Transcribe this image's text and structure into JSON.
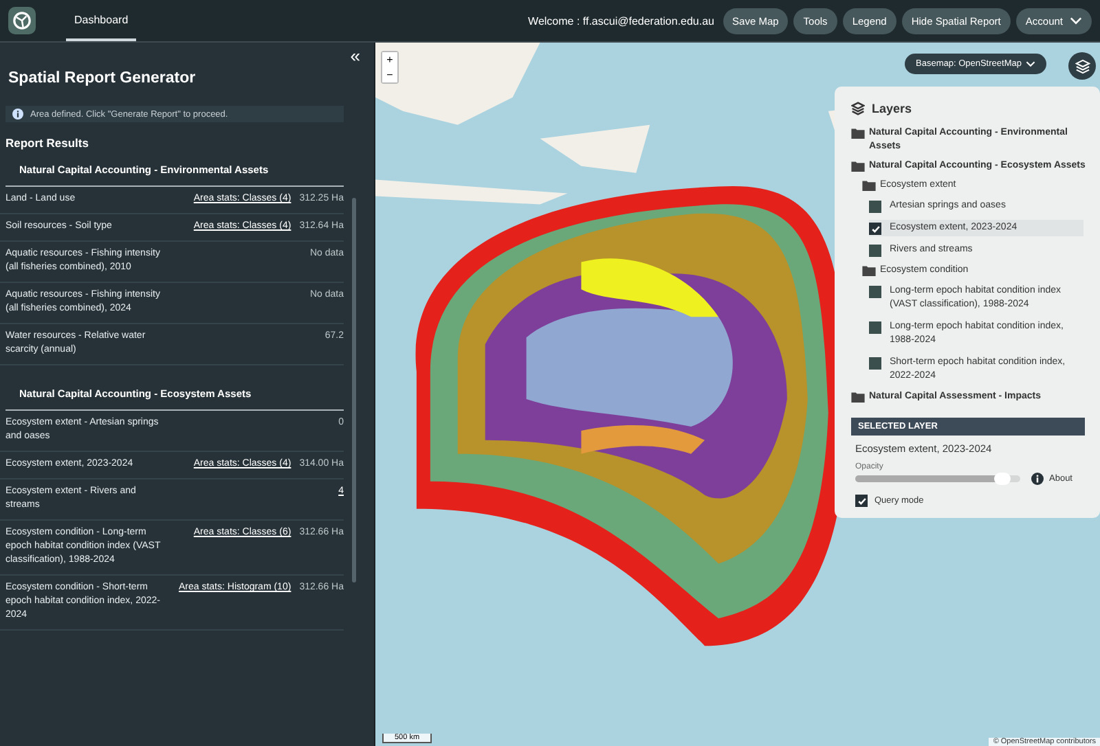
{
  "topbar": {
    "tabs": [
      {
        "label": "Dashboard",
        "selected": true
      }
    ],
    "welcome": "Welcome : ff.ascui@federation.edu.au",
    "buttons": [
      {
        "label": "Save Map",
        "kind": "plain"
      },
      {
        "label": "Tools",
        "kind": "plain"
      },
      {
        "label": "Legend",
        "kind": "plain"
      },
      {
        "label": "Hide Spatial Report",
        "kind": "plain"
      },
      {
        "label": "Account",
        "kind": "dropdown"
      }
    ]
  },
  "sidebar": {
    "collapse": "«",
    "title": "Spatial Report Generator",
    "alert": "Area defined. Click \"Generate Report\" to proceed.",
    "results_title": "Report Results",
    "sections": [
      {
        "title": "Natural Capital Accounting - Environmental Assets",
        "rows": [
          {
            "label": "Land - Land use",
            "link": "Area stats: Classes (4)",
            "value": "312.25 Ha"
          },
          {
            "label": "Soil resources - Soil type",
            "link": "Area stats: Classes (4)",
            "value": "312.64 Ha"
          },
          {
            "label": "Aquatic resources - Fishing intensity (all fisheries combined), 2010",
            "value": "No data"
          },
          {
            "label": "Aquatic resources - Fishing intensity (all fisheries combined), 2024",
            "value": "No data"
          },
          {
            "label": "Water resources - Relative water scarcity (annual)",
            "value": "67.2"
          }
        ]
      },
      {
        "title": "Natural Capital Accounting - Ecosystem Assets",
        "rows": [
          {
            "label": "Ecosystem extent - Artesian springs and oases",
            "value": "0"
          },
          {
            "label": "Ecosystem extent, 2023-2024",
            "link": "Area stats: Classes (4)",
            "value": "314.00 Ha"
          },
          {
            "label": "Ecosystem extent - Rivers and streams",
            "link": "4"
          },
          {
            "label": "Ecosystem condition - Long-term epoch habitat condition index (VAST classification), 1988-2024",
            "link": "Area stats: Classes (6)",
            "value": "312.66 Ha"
          },
          {
            "label": "Ecosystem condition - Short-term epoch habitat condition index, 2022-2024",
            "link": "Area stats: Histogram (10)",
            "value": "312.66 Ha"
          }
        ]
      }
    ]
  },
  "map": {
    "zoom_in": "+",
    "zoom_out": "−",
    "basemap_label": "Basemap:",
    "basemap": "OpenStreetMap",
    "scale": "500 km",
    "attribution": "© OpenStreetMap contributors"
  },
  "layers": {
    "title": "Layers",
    "tree": [
      {
        "label": "Natural Capital Accounting - Environmental Assets"
      },
      {
        "label": "Natural Capital Accounting - Ecosystem Assets",
        "children": [
          {
            "label": "Ecosystem extent",
            "children": [
              {
                "label": "Artesian springs and oases",
                "checked": false,
                "selected": false
              },
              {
                "label": "Ecosystem extent, 2023-2024",
                "checked": true,
                "selected": true
              },
              {
                "label": "Rivers and streams",
                "checked": false,
                "selected": false
              }
            ]
          },
          {
            "label": "Ecosystem condition",
            "children": [
              {
                "label": "Long-term epoch habitat condition index (VAST classification), 1988-2024",
                "checked": false,
                "selected": false
              },
              {
                "label": "Long-term epoch habitat condition index, 1988-2024",
                "checked": false,
                "selected": false
              },
              {
                "label": "Short-term epoch habitat condition index, 2022-2024",
                "checked": false,
                "selected": false
              }
            ]
          }
        ]
      },
      {
        "label": "Natural Capital Assessment - Impacts"
      }
    ],
    "selected_header": "SELECTED LAYER",
    "selected_name": "Ecosystem extent, 2023-2024",
    "opacity_label": "Opacity",
    "opacity": {
      "level": 0.9
    },
    "about": "About",
    "query_mode": {
      "label": "Query mode",
      "checked": true
    }
  }
}
